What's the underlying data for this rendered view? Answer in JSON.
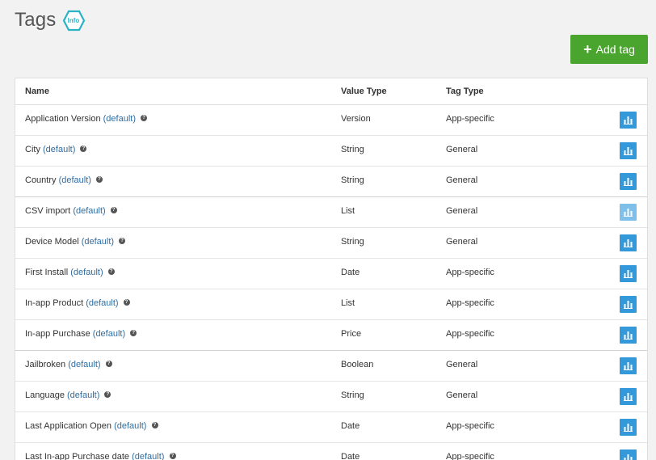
{
  "page": {
    "title": "Tags",
    "info_badge": "Info"
  },
  "toolbar": {
    "add_tag_label": "Add tag",
    "add_tag_icon": "+"
  },
  "table": {
    "columns": {
      "name": "Name",
      "value_type": "Value Type",
      "tag_type": "Tag Type"
    },
    "default_label": "(default)",
    "rows": [
      {
        "name": "Application Version",
        "value_type": "Version",
        "tag_type": "App-specific"
      },
      {
        "name": "City",
        "value_type": "String",
        "tag_type": "General"
      },
      {
        "name": "Country",
        "value_type": "String",
        "tag_type": "General"
      },
      {
        "name": "CSV import",
        "value_type": "List",
        "tag_type": "General"
      },
      {
        "name": "Device Model",
        "value_type": "String",
        "tag_type": "General"
      },
      {
        "name": "First Install",
        "value_type": "Date",
        "tag_type": "App-specific"
      },
      {
        "name": "In-app Product",
        "value_type": "List",
        "tag_type": "App-specific"
      },
      {
        "name": "In-app Purchase",
        "value_type": "Price",
        "tag_type": "App-specific"
      },
      {
        "name": "Jailbroken",
        "value_type": "Boolean",
        "tag_type": "General"
      },
      {
        "name": "Language",
        "value_type": "String",
        "tag_type": "General"
      },
      {
        "name": "Last Application Open",
        "value_type": "Date",
        "tag_type": "App-specific"
      },
      {
        "name": "Last In-app Purchase date",
        "value_type": "Date",
        "tag_type": "App-specific"
      }
    ]
  },
  "colors": {
    "accent_green": "#4aa52e",
    "chart_button_blue": "#3499db",
    "chart_button_light": "#7fc0ea",
    "link_blue": "#2e6da4",
    "info_teal": "#2bb3c5"
  },
  "icons": {
    "info": "info-hexagon-icon",
    "help": "question-circle-icon",
    "chart": "bar-chart-icon",
    "add": "plus-icon"
  }
}
